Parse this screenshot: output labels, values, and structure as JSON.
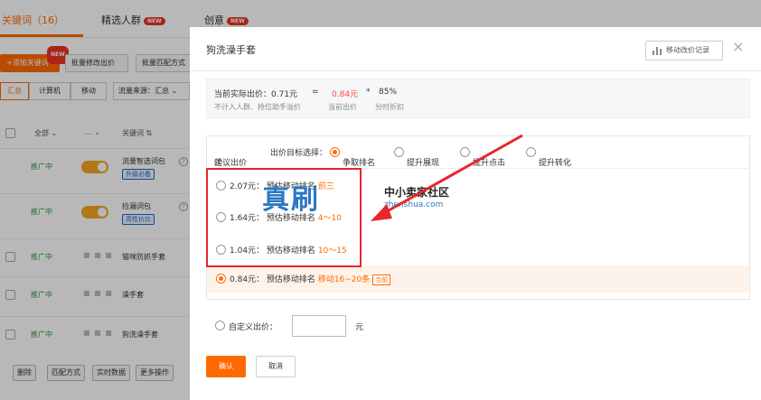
{
  "tabs": [
    {
      "label": "关键词（16）",
      "new": false
    },
    {
      "label": "精选人群",
      "new": true
    },
    {
      "label": "创意",
      "new": true
    }
  ],
  "new_badge": "NEW",
  "toolbar": {
    "add_keyword": "+添加关键词",
    "batch_price": "批量修改出价",
    "batch_match": "批量匹配方式"
  },
  "device_segments": [
    "汇总",
    "计算机",
    "移动"
  ],
  "traffic_source": "流量来源：汇总",
  "table_head": {
    "all": "全部",
    "dots": "...",
    "keyword": "关键词"
  },
  "rows": [
    {
      "status": "推广中",
      "keyword": "流量智选词包",
      "tag": "升级必备",
      "toggle": true
    },
    {
      "status": "推广中",
      "keyword": "捡漏词包",
      "tag": "高性价比",
      "toggle": true
    },
    {
      "status": "推广中",
      "keyword": "猫咪防抓手套",
      "tag": "",
      "toggle": false
    },
    {
      "status": "推广中",
      "keyword": "澡手套",
      "tag": "",
      "toggle": false
    },
    {
      "status": "推广中",
      "keyword": "狗洗澡手套",
      "tag": "",
      "toggle": false
    }
  ],
  "bottom_buttons": [
    "删除",
    "匹配方式",
    "实时数据",
    "更多操作"
  ],
  "modal": {
    "title": "狗洗澡手套",
    "record_button": "移动改价记录",
    "close": "×",
    "calc": {
      "actual_label": "当前实际出价：0.71元",
      "equals": "=",
      "current_price": "0.84元",
      "times": "*",
      "percent": "85%",
      "note1": "不计入人群、抢位助手溢价",
      "note2": "当前出价",
      "note3": "分时折扣"
    },
    "suggest_label": "建议出价",
    "target_label": "出价目标选择：",
    "targets": [
      "争取排名",
      "提升展现",
      "提升点击",
      "提升转化"
    ],
    "options": [
      {
        "price": "2.07元：",
        "desc": "预估移动排名",
        "rank": "前三"
      },
      {
        "price": "1.64元：",
        "desc": "预估移动排名",
        "rank": "4～10"
      },
      {
        "price": "1.04元：",
        "desc": "预估移动排名",
        "rank": "10～15"
      }
    ],
    "current_option": {
      "price": "0.84元：",
      "desc": "预估移动排名",
      "rank": "移动16~20条",
      "badge": "当前"
    },
    "custom_label": "自定义出价：",
    "custom_unit": "元",
    "confirm": "确认",
    "cancel": "取消"
  },
  "watermark": {
    "big": "真刷",
    "cn": "中小卖家社区",
    "en": "zhenshua.com"
  },
  "colors": {
    "accent": "#ff6a00",
    "highlight_box": "#e8262b",
    "status_green": "#2c9a3a"
  }
}
